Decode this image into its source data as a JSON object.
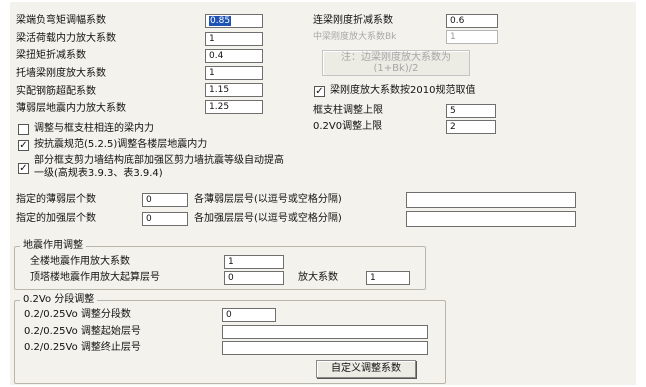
{
  "left_params": [
    {
      "label": "梁端负弯矩调幅系数",
      "value": "0.85"
    },
    {
      "label": "梁活荷载内力放大系数",
      "value": "1"
    },
    {
      "label": "梁扭矩折减系数",
      "value": "0.4"
    },
    {
      "label": "托墙梁刚度放大系数",
      "value": "1"
    },
    {
      "label": "实配钢筋超配系数",
      "value": "1.15"
    },
    {
      "label": "薄弱层地震内力放大系数",
      "value": "1.25"
    }
  ],
  "right_params": {
    "link_beam_label": "连梁刚度折减系数",
    "link_beam_value": "0.6",
    "mid_beam_label": "中梁刚度放大系数Bk",
    "mid_beam_value": "1",
    "note_line1": "注：边梁刚度放大系数为",
    "note_line2": "(1+Bk)/2",
    "code2010_label": "梁刚度放大系数按2010规范取值",
    "frame_col_label": "框支柱调整上限",
    "frame_col_value": "5",
    "v02_label": "0.2V0调整上限",
    "v02_value": "2"
  },
  "checkboxes": {
    "adjust_beam_label": "调整与框支柱相连的梁内力",
    "seismic_code_label": "按抗震规范(5.2.5)调整各楼层地震内力",
    "frame_support_line1": "部分框支剪力墙结构底部加强区剪力墙抗震等级自动提高",
    "frame_support_line2": "一级(高规表3.9.3、表3.9.4)"
  },
  "layers": {
    "weak_count_label": "指定的薄弱层个数",
    "weak_count_value": "0",
    "weak_list_label": "各薄弱层层号(以逗号或空格分隔)",
    "weak_list_value": "",
    "strong_count_label": "指定的加强层个数",
    "strong_count_value": "0",
    "strong_list_label": "各加强层层号(以逗号或空格分隔)",
    "strong_list_value": ""
  },
  "seismic_group": {
    "title": "地震作用调整",
    "full_amp_label": "全楼地震作用放大系数",
    "full_amp_value": "1",
    "top_start_label": "顶塔楼地震作用放大起算层号",
    "top_start_value": "0",
    "amp_label": "放大系数",
    "amp_value": "1"
  },
  "v02_group": {
    "title": "0.2Vo 分段调整",
    "segments_label": "0.2/0.25Vo 调整分段数",
    "segments_value": "0",
    "start_label": "0.2/0.25Vo 调整起始层号",
    "start_value": "",
    "end_label": "0.2/0.25Vo 调整终止层号",
    "end_value": "",
    "custom_button": "自定义调整系数"
  }
}
